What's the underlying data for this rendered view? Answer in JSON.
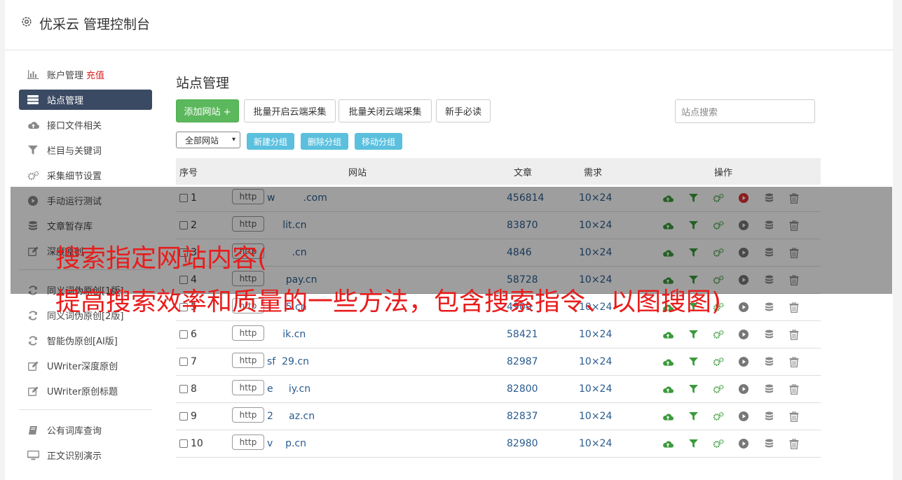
{
  "header": {
    "title": "优采云 管理控制台"
  },
  "sidebar": {
    "items": [
      {
        "label": "账户管理",
        "extra": "充值",
        "icon": "bar-chart-icon"
      },
      {
        "label": "站点管理",
        "icon": "server-icon",
        "active": true
      },
      {
        "label": "接口文件相关",
        "icon": "cloud-upload-icon"
      },
      {
        "label": "栏目与关键词",
        "icon": "filter-icon"
      },
      {
        "label": "采集细节设置",
        "icon": "gears-icon"
      },
      {
        "label": "手动运行测试",
        "icon": "play-circle-icon"
      },
      {
        "label": "文章暂存库",
        "icon": "database-icon"
      },
      {
        "label": "深度原创",
        "icon": "edit-icon"
      }
    ],
    "items2": [
      {
        "label": "同义词伪原创[1版]",
        "icon": "refresh-icon"
      },
      {
        "label": "同义词伪原创[2版]",
        "icon": "refresh-icon"
      },
      {
        "label": "智能伪原创[AI版]",
        "icon": "refresh-icon"
      },
      {
        "label": "UWriter深度原创",
        "icon": "edit-icon"
      },
      {
        "label": "UWriter原创标题",
        "icon": "edit-icon"
      }
    ],
    "items3": [
      {
        "label": "公有词库查询",
        "icon": "book-icon"
      },
      {
        "label": "正文识别演示",
        "icon": "monitor-icon"
      }
    ]
  },
  "main": {
    "title": "站点管理",
    "buttons": {
      "add": "添加网站 +",
      "batch_open": "批量开启云端采集",
      "batch_close": "批量关闭云端采集",
      "guide": "新手必读"
    },
    "search_placeholder": "站点搜索",
    "group_select": "全部网站",
    "group_buttons": {
      "new": "新建分组",
      "delete": "删除分组",
      "move": "移动分组"
    }
  },
  "table": {
    "headers": {
      "index": "序号",
      "site": "网站",
      "articles": "文章",
      "demand": "需求",
      "ops": "操作"
    },
    "rows": [
      {
        "n": "1",
        "proto": "http",
        "site": "w         .com",
        "articles": "456814",
        "demand": "10×24",
        "play_active": true
      },
      {
        "n": "2",
        "proto": "http",
        "site": "     lit.cn",
        "articles": "83870",
        "demand": "10×24"
      },
      {
        "n": "3",
        "proto": "http",
        "site": "        .cn",
        "articles": "4846",
        "demand": "10×24"
      },
      {
        "n": "4",
        "proto": "http",
        "site": "      pay.cn",
        "articles": "58728",
        "demand": "10×24"
      },
      {
        "n": "5",
        "proto": "http",
        "site": "      5.cn",
        "articles": "4909",
        "demand": "10×24"
      },
      {
        "n": "6",
        "proto": "http",
        "site": "     ik.cn",
        "articles": "58421",
        "demand": "10×24"
      },
      {
        "n": "7",
        "proto": "http",
        "site": "sf  29.cn",
        "articles": "82987",
        "demand": "10×24"
      },
      {
        "n": "8",
        "proto": "http",
        "site": "e     iy.cn",
        "articles": "82800",
        "demand": "10×24"
      },
      {
        "n": "9",
        "proto": "http",
        "site": "2     az.cn",
        "articles": "82837",
        "demand": "10×24"
      },
      {
        "n": "10",
        "proto": "http",
        "site": "v    p.cn",
        "articles": "82980",
        "demand": "10×24"
      }
    ]
  },
  "overlay": {
    "line1": "搜索指定网站内容(",
    "line2": "提高搜索效率和质量的一些方法，包含搜索指令、以图搜图)"
  },
  "colors": {
    "green": "#5cb85c",
    "sidebar_active": "#3a4a63",
    "info": "#5bc0de",
    "overlay_text": "#e81c1c",
    "link_blue": "#2a5b8f"
  }
}
